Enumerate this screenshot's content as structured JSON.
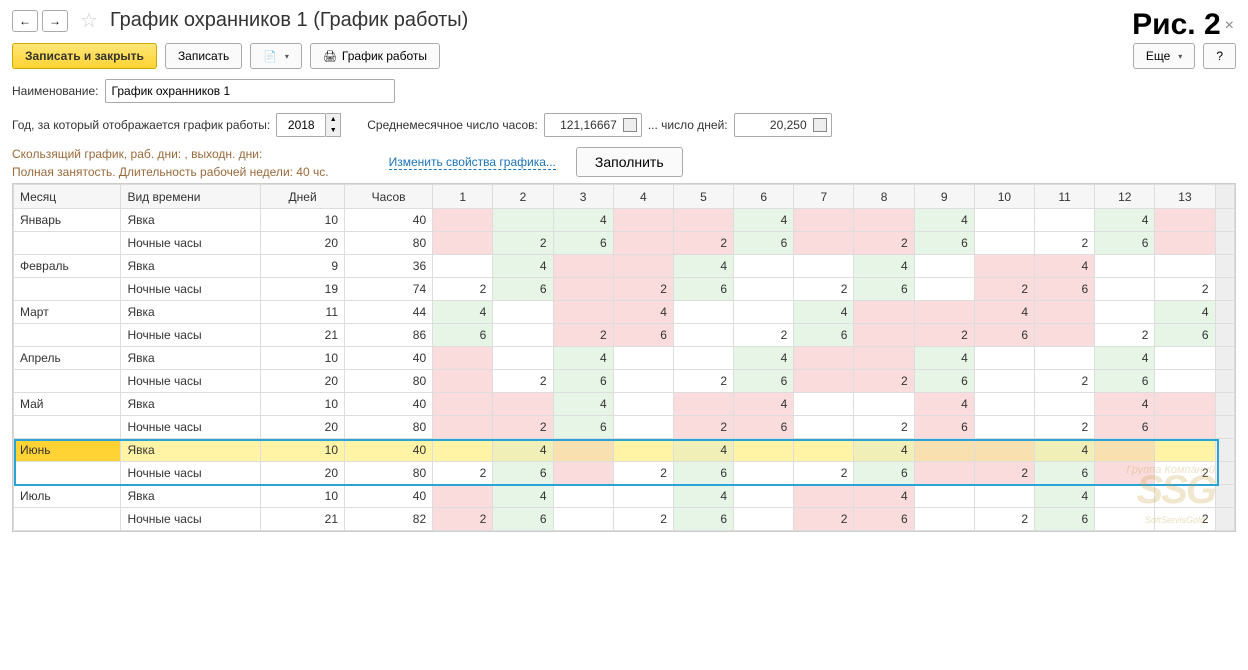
{
  "figure": "Рис. 2",
  "title": "График охранников 1 (График работы)",
  "toolbar": {
    "save_close": "Записать и закрыть",
    "save": "Записать",
    "print": "График работы",
    "more": "Еще",
    "help": "?"
  },
  "fields": {
    "name_label": "Наименование:",
    "name_value": "График охранников 1",
    "year_label": "Год, за который отображается график работы:",
    "year_value": "2018",
    "avg_hours_label": "Среднемесячное число часов:",
    "avg_hours_value": "121,16667",
    "days_label": "... число дней:",
    "days_value": "20,250"
  },
  "info": {
    "line1": "Скользящий график, раб. дни: , выходн. дни:",
    "line2": "Полная занятость. Длительность рабочей недели: 40 чс."
  },
  "actions": {
    "change_props": "Изменить свойства графика...",
    "fill": "Заполнить"
  },
  "watermark": {
    "line1": "Группа Компаний",
    "logo": "SSG",
    "line2": "SoftServisGold"
  },
  "grid": {
    "headers": [
      "Месяц",
      "Вид времени",
      "Дней",
      "Часов",
      "1",
      "2",
      "3",
      "4",
      "5",
      "6",
      "7",
      "8",
      "9",
      "10",
      "11",
      "12",
      "13"
    ],
    "selected_month_index": 5,
    "rows": [
      {
        "month": "Январь",
        "type": "Явка",
        "days": 10,
        "hours": 40,
        "cells": [
          {
            "v": "",
            "c": "p"
          },
          {
            "v": "",
            "c": "g"
          },
          {
            "v": 4,
            "c": "g"
          },
          {
            "v": "",
            "c": "p"
          },
          {
            "v": "",
            "c": "p"
          },
          {
            "v": 4,
            "c": "g"
          },
          {
            "v": "",
            "c": "p"
          },
          {
            "v": "",
            "c": "p"
          },
          {
            "v": 4,
            "c": "g"
          },
          {
            "v": "",
            "c": ""
          },
          {
            "v": "",
            "c": ""
          },
          {
            "v": 4,
            "c": "g"
          },
          {
            "v": "",
            "c": "p"
          }
        ]
      },
      {
        "month": "",
        "type": "Ночные часы",
        "days": 20,
        "hours": 80,
        "cells": [
          {
            "v": "",
            "c": "p"
          },
          {
            "v": 2,
            "c": "g"
          },
          {
            "v": 6,
            "c": "g"
          },
          {
            "v": "",
            "c": "p"
          },
          {
            "v": 2,
            "c": "p"
          },
          {
            "v": 6,
            "c": "g"
          },
          {
            "v": "",
            "c": "p"
          },
          {
            "v": 2,
            "c": "p"
          },
          {
            "v": 6,
            "c": "g"
          },
          {
            "v": "",
            "c": ""
          },
          {
            "v": 2,
            "c": ""
          },
          {
            "v": 6,
            "c": "g"
          },
          {
            "v": "",
            "c": "p"
          }
        ]
      },
      {
        "month": "Февраль",
        "type": "Явка",
        "days": 9,
        "hours": 36,
        "cells": [
          {
            "v": "",
            "c": ""
          },
          {
            "v": 4,
            "c": "g"
          },
          {
            "v": "",
            "c": "p"
          },
          {
            "v": "",
            "c": "p"
          },
          {
            "v": 4,
            "c": "g"
          },
          {
            "v": "",
            "c": ""
          },
          {
            "v": "",
            "c": ""
          },
          {
            "v": 4,
            "c": "g"
          },
          {
            "v": "",
            "c": ""
          },
          {
            "v": "",
            "c": "p"
          },
          {
            "v": 4,
            "c": "p"
          },
          {
            "v": "",
            "c": ""
          },
          {
            "v": "",
            "c": ""
          }
        ]
      },
      {
        "month": "",
        "type": "Ночные часы",
        "days": 19,
        "hours": 74,
        "cells": [
          {
            "v": 2,
            "c": ""
          },
          {
            "v": 6,
            "c": "g"
          },
          {
            "v": "",
            "c": "p"
          },
          {
            "v": 2,
            "c": "p"
          },
          {
            "v": 6,
            "c": "g"
          },
          {
            "v": "",
            "c": ""
          },
          {
            "v": 2,
            "c": ""
          },
          {
            "v": 6,
            "c": "g"
          },
          {
            "v": "",
            "c": ""
          },
          {
            "v": 2,
            "c": "p"
          },
          {
            "v": 6,
            "c": "p"
          },
          {
            "v": "",
            "c": ""
          },
          {
            "v": 2,
            "c": ""
          }
        ]
      },
      {
        "month": "Март",
        "type": "Явка",
        "days": 11,
        "hours": 44,
        "cells": [
          {
            "v": 4,
            "c": "g"
          },
          {
            "v": "",
            "c": ""
          },
          {
            "v": "",
            "c": "p"
          },
          {
            "v": 4,
            "c": "p"
          },
          {
            "v": "",
            "c": ""
          },
          {
            "v": "",
            "c": ""
          },
          {
            "v": 4,
            "c": "g"
          },
          {
            "v": "",
            "c": "p"
          },
          {
            "v": "",
            "c": "p"
          },
          {
            "v": 4,
            "c": "p"
          },
          {
            "v": "",
            "c": "p"
          },
          {
            "v": "",
            "c": ""
          },
          {
            "v": 4,
            "c": "g"
          }
        ]
      },
      {
        "month": "",
        "type": "Ночные часы",
        "days": 21,
        "hours": 86,
        "cells": [
          {
            "v": 6,
            "c": "g"
          },
          {
            "v": "",
            "c": ""
          },
          {
            "v": 2,
            "c": "p"
          },
          {
            "v": 6,
            "c": "p"
          },
          {
            "v": "",
            "c": ""
          },
          {
            "v": 2,
            "c": ""
          },
          {
            "v": 6,
            "c": "g"
          },
          {
            "v": "",
            "c": "p"
          },
          {
            "v": 2,
            "c": "p"
          },
          {
            "v": 6,
            "c": "p"
          },
          {
            "v": "",
            "c": "p"
          },
          {
            "v": 2,
            "c": ""
          },
          {
            "v": 6,
            "c": "g"
          }
        ]
      },
      {
        "month": "Апрель",
        "type": "Явка",
        "days": 10,
        "hours": 40,
        "cells": [
          {
            "v": "",
            "c": "p"
          },
          {
            "v": "",
            "c": ""
          },
          {
            "v": 4,
            "c": "g"
          },
          {
            "v": "",
            "c": ""
          },
          {
            "v": "",
            "c": ""
          },
          {
            "v": 4,
            "c": "g"
          },
          {
            "v": "",
            "c": "p"
          },
          {
            "v": "",
            "c": "p"
          },
          {
            "v": 4,
            "c": "g"
          },
          {
            "v": "",
            "c": ""
          },
          {
            "v": "",
            "c": ""
          },
          {
            "v": 4,
            "c": "g"
          },
          {
            "v": "",
            "c": ""
          }
        ]
      },
      {
        "month": "",
        "type": "Ночные часы",
        "days": 20,
        "hours": 80,
        "cells": [
          {
            "v": "",
            "c": "p"
          },
          {
            "v": 2,
            "c": ""
          },
          {
            "v": 6,
            "c": "g"
          },
          {
            "v": "",
            "c": ""
          },
          {
            "v": 2,
            "c": ""
          },
          {
            "v": 6,
            "c": "g"
          },
          {
            "v": "",
            "c": "p"
          },
          {
            "v": 2,
            "c": "p"
          },
          {
            "v": 6,
            "c": "g"
          },
          {
            "v": "",
            "c": ""
          },
          {
            "v": 2,
            "c": ""
          },
          {
            "v": 6,
            "c": "g"
          },
          {
            "v": "",
            "c": ""
          }
        ]
      },
      {
        "month": "Май",
        "type": "Явка",
        "days": 10,
        "hours": 40,
        "cells": [
          {
            "v": "",
            "c": "p"
          },
          {
            "v": "",
            "c": "p"
          },
          {
            "v": 4,
            "c": "g"
          },
          {
            "v": "",
            "c": ""
          },
          {
            "v": "",
            "c": "p"
          },
          {
            "v": 4,
            "c": "p"
          },
          {
            "v": "",
            "c": ""
          },
          {
            "v": "",
            "c": ""
          },
          {
            "v": 4,
            "c": "p"
          },
          {
            "v": "",
            "c": ""
          },
          {
            "v": "",
            "c": ""
          },
          {
            "v": 4,
            "c": "p"
          },
          {
            "v": "",
            "c": "p"
          }
        ]
      },
      {
        "month": "",
        "type": "Ночные часы",
        "days": 20,
        "hours": 80,
        "cells": [
          {
            "v": "",
            "c": "p"
          },
          {
            "v": 2,
            "c": "p"
          },
          {
            "v": 6,
            "c": "g"
          },
          {
            "v": "",
            "c": ""
          },
          {
            "v": 2,
            "c": "p"
          },
          {
            "v": 6,
            "c": "p"
          },
          {
            "v": "",
            "c": ""
          },
          {
            "v": 2,
            "c": ""
          },
          {
            "v": 6,
            "c": "p"
          },
          {
            "v": "",
            "c": ""
          },
          {
            "v": 2,
            "c": ""
          },
          {
            "v": 6,
            "c": "p"
          },
          {
            "v": "",
            "c": "p"
          }
        ]
      },
      {
        "month": "Июнь",
        "type": "Явка",
        "days": 10,
        "hours": 40,
        "cells": [
          {
            "v": "",
            "c": ""
          },
          {
            "v": 4,
            "c": "sg"
          },
          {
            "v": "",
            "c": "sp"
          },
          {
            "v": "",
            "c": ""
          },
          {
            "v": 4,
            "c": "sg"
          },
          {
            "v": "",
            "c": ""
          },
          {
            "v": "",
            "c": ""
          },
          {
            "v": 4,
            "c": "sg"
          },
          {
            "v": "",
            "c": "sp"
          },
          {
            "v": "",
            "c": "sp"
          },
          {
            "v": 4,
            "c": "sg"
          },
          {
            "v": "",
            "c": "sp"
          },
          {
            "v": "",
            "c": ""
          }
        ]
      },
      {
        "month": "",
        "type": "Ночные часы",
        "days": 20,
        "hours": 80,
        "cells": [
          {
            "v": 2,
            "c": ""
          },
          {
            "v": 6,
            "c": "g"
          },
          {
            "v": "",
            "c": "p"
          },
          {
            "v": 2,
            "c": ""
          },
          {
            "v": 6,
            "c": "g"
          },
          {
            "v": "",
            "c": ""
          },
          {
            "v": 2,
            "c": ""
          },
          {
            "v": 6,
            "c": "g"
          },
          {
            "v": "",
            "c": "p"
          },
          {
            "v": 2,
            "c": "p"
          },
          {
            "v": 6,
            "c": "g"
          },
          {
            "v": "",
            "c": "p"
          },
          {
            "v": 2,
            "c": ""
          }
        ]
      },
      {
        "month": "Июль",
        "type": "Явка",
        "days": 10,
        "hours": 40,
        "cells": [
          {
            "v": "",
            "c": "p"
          },
          {
            "v": 4,
            "c": "g"
          },
          {
            "v": "",
            "c": ""
          },
          {
            "v": "",
            "c": ""
          },
          {
            "v": 4,
            "c": "g"
          },
          {
            "v": "",
            "c": ""
          },
          {
            "v": "",
            "c": "p"
          },
          {
            "v": 4,
            "c": "p"
          },
          {
            "v": "",
            "c": ""
          },
          {
            "v": "",
            "c": ""
          },
          {
            "v": 4,
            "c": "g"
          },
          {
            "v": "",
            "c": ""
          },
          {
            "v": "",
            "c": ""
          }
        ]
      },
      {
        "month": "",
        "type": "Ночные часы",
        "days": 21,
        "hours": 82,
        "cells": [
          {
            "v": 2,
            "c": "p"
          },
          {
            "v": 6,
            "c": "g"
          },
          {
            "v": "",
            "c": ""
          },
          {
            "v": 2,
            "c": ""
          },
          {
            "v": 6,
            "c": "g"
          },
          {
            "v": "",
            "c": ""
          },
          {
            "v": 2,
            "c": "p"
          },
          {
            "v": 6,
            "c": "p"
          },
          {
            "v": "",
            "c": ""
          },
          {
            "v": 2,
            "c": ""
          },
          {
            "v": 6,
            "c": "g"
          },
          {
            "v": "",
            "c": ""
          },
          {
            "v": 2,
            "c": ""
          }
        ]
      }
    ]
  }
}
